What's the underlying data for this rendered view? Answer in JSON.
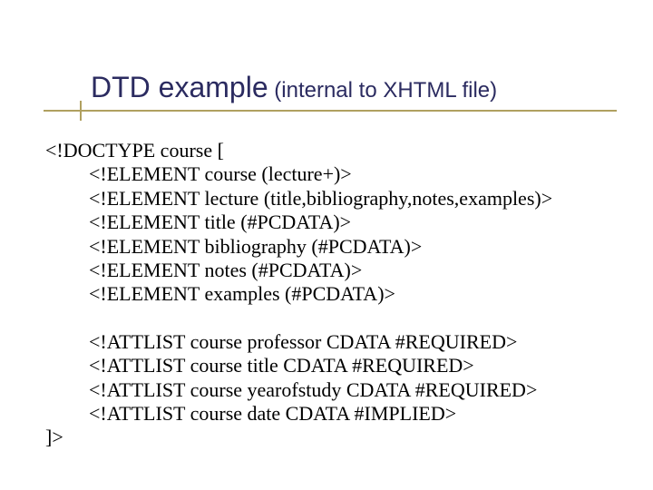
{
  "title": {
    "main": "DTD example",
    "sub": " (internal to XHTML file)"
  },
  "dtd": {
    "open": "<!DOCTYPE course [",
    "elements": [
      "<!ELEMENT course (lecture+)>",
      "<!ELEMENT lecture (title,bibliography,notes,examples)>",
      "<!ELEMENT title (#PCDATA)>",
      "<!ELEMENT bibliography (#PCDATA)>",
      "<!ELEMENT notes (#PCDATA)>",
      "<!ELEMENT examples (#PCDATA)>"
    ],
    "attlists": [
      "<!ATTLIST course professor CDATA #REQUIRED>",
      "<!ATTLIST course title CDATA #REQUIRED>",
      "<!ATTLIST course yearofstudy CDATA #REQUIRED>",
      "<!ATTLIST course date CDATA #IMPLIED>"
    ],
    "close": "]>"
  }
}
